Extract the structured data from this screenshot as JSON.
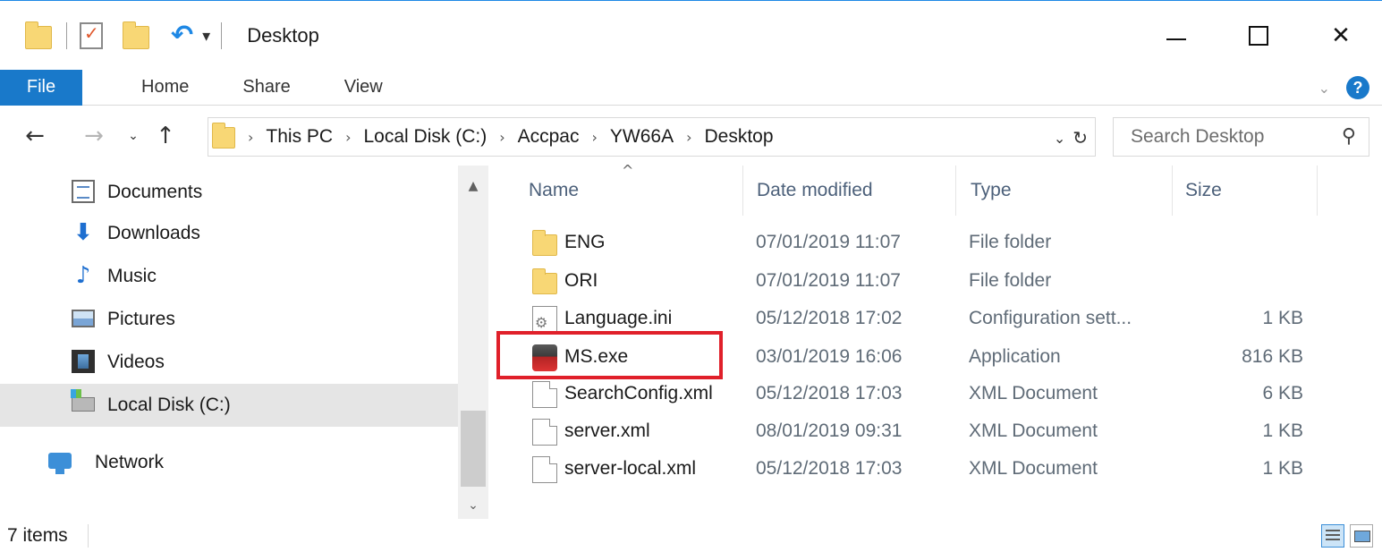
{
  "window": {
    "title": "Desktop",
    "controls": {
      "minimize": "minimize",
      "maximize": "maximize",
      "close": "✕"
    }
  },
  "ribbon": {
    "tabs": [
      "File",
      "Home",
      "Share",
      "View"
    ]
  },
  "address": {
    "crumbs": [
      "This PC",
      "Local Disk (C:)",
      "Accpac",
      "YW66A",
      "Desktop"
    ],
    "search_placeholder": "Search Desktop"
  },
  "nav": {
    "items": [
      {
        "label": "Documents",
        "icon": "documents-icon"
      },
      {
        "label": "Downloads",
        "icon": "downloads-icon"
      },
      {
        "label": "Music",
        "icon": "music-icon"
      },
      {
        "label": "Pictures",
        "icon": "pictures-icon"
      },
      {
        "label": "Videos",
        "icon": "videos-icon"
      },
      {
        "label": "Local Disk (C:)",
        "icon": "local-disk-icon",
        "selected": true
      },
      {
        "label": "Network",
        "icon": "network-icon"
      }
    ]
  },
  "filelist": {
    "columns": [
      "Name",
      "Date modified",
      "Type",
      "Size"
    ],
    "sort_indicator": "^",
    "rows": [
      {
        "name": "ENG",
        "date": "07/01/2019 11:07",
        "type": "File folder",
        "size": "",
        "icon": "folder-icon"
      },
      {
        "name": "ORI",
        "date": "07/01/2019 11:07",
        "type": "File folder",
        "size": "",
        "icon": "folder-icon"
      },
      {
        "name": "Language.ini",
        "date": "05/12/2018 17:02",
        "type": "Configuration sett...",
        "size": "1 KB",
        "icon": "config-file-icon"
      },
      {
        "name": "MS.exe",
        "date": "03/01/2019 16:06",
        "type": "Application",
        "size": "816 KB",
        "icon": "application-icon",
        "highlighted": true
      },
      {
        "name": "SearchConfig.xml",
        "date": "05/12/2018 17:03",
        "type": "XML Document",
        "size": "6 KB",
        "icon": "xml-file-icon"
      },
      {
        "name": "server.xml",
        "date": "08/01/2019 09:31",
        "type": "XML Document",
        "size": "1 KB",
        "icon": "xml-file-icon"
      },
      {
        "name": "server-local.xml",
        "date": "05/12/2018 17:03",
        "type": "XML Document",
        "size": "1 KB",
        "icon": "xml-file-icon"
      }
    ]
  },
  "status": {
    "item_count": "7 items"
  },
  "colors": {
    "accent": "#1979ca",
    "highlight_border": "#e0202a",
    "selected_nav": "#e5e5e5"
  }
}
